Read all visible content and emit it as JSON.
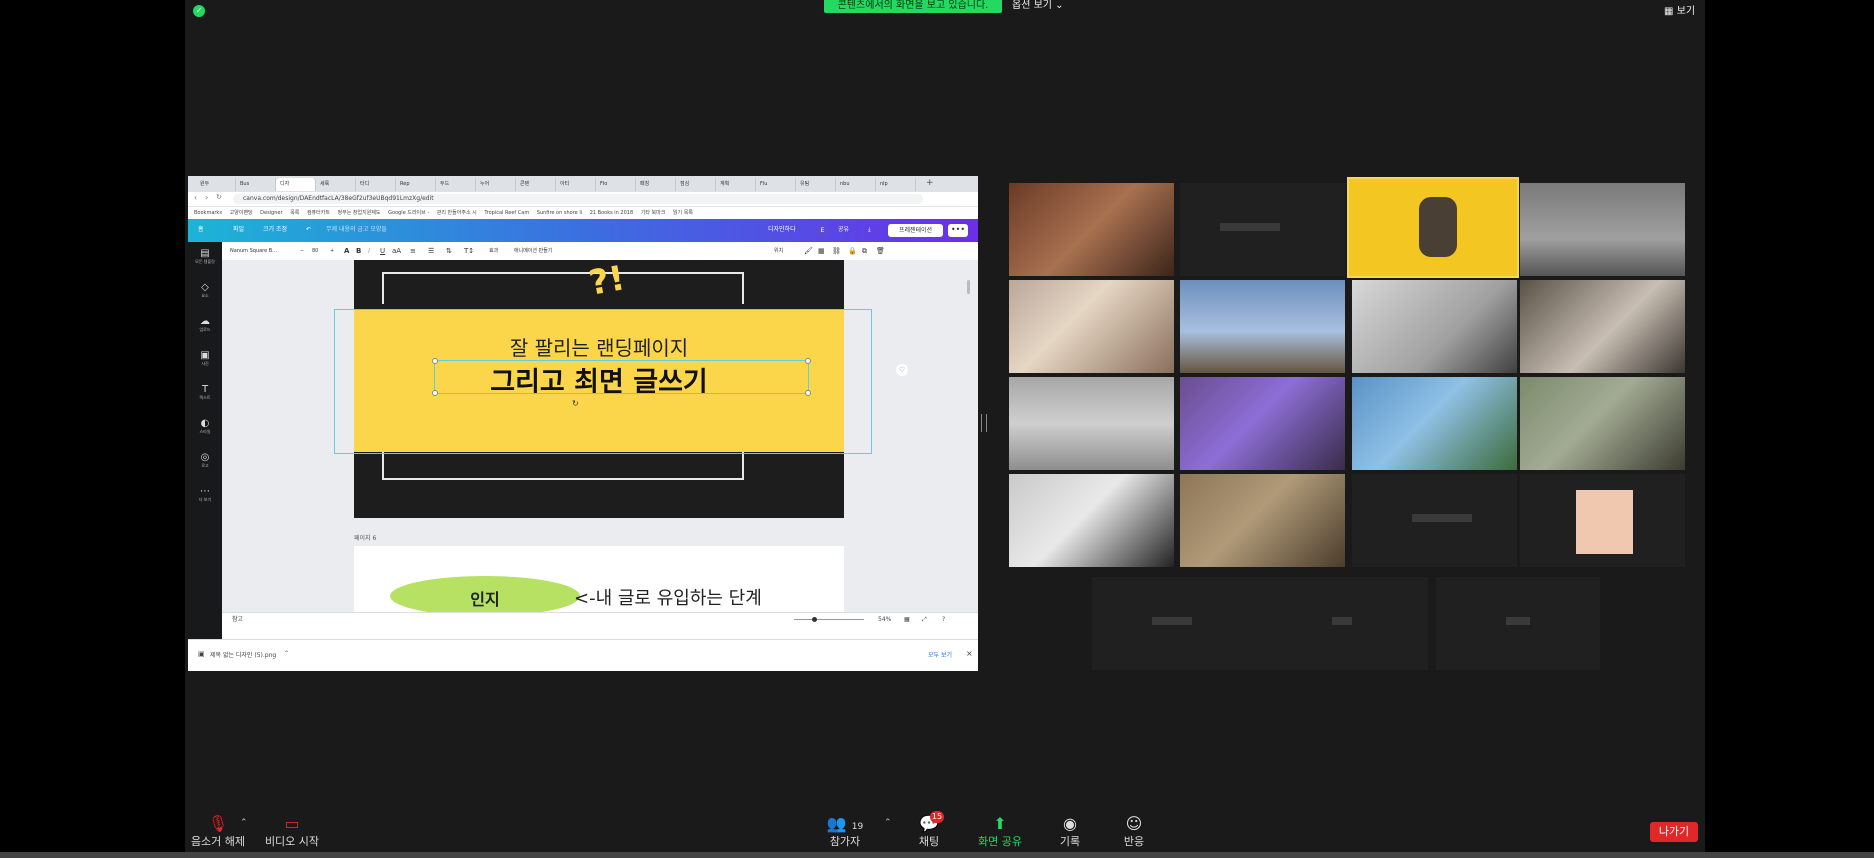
{
  "zoom": {
    "share_banner": "콘텐츠에서의 화면을 보고 있습니다.",
    "view_options": "옵션 보기 ⌄",
    "view_button": "보기",
    "controls": {
      "mute": "음소거 해제",
      "video": "비디오 시작",
      "participants": "참가자",
      "participants_count": "19",
      "chat": "채팅",
      "chat_badge": "15",
      "share": "화면 공유",
      "record": "기록",
      "reactions": "반응",
      "leave": "나가기"
    }
  },
  "browser": {
    "url": "canva.com/design/DAEndtfacLA/38eGf2uf3eUBqd91LmzXg/edit",
    "bookmarks": [
      "Bookmarks",
      "고양이펜딩",
      "Designer",
      "목록",
      "컴퓨터카트",
      "정부는 창업지원제도",
      "Google 드라이브 -",
      "관리 만들어주소 시",
      "Tropical Reef Cam",
      "Sunfire on shore li",
      "21 Books in 2018",
      "기타 북마크",
      "읽기 목록"
    ],
    "tabs": [
      "원두",
      "Bus",
      "디자",
      "세륙",
      "타디",
      "Rep",
      "두드",
      "누어",
      "콘텐",
      "아티",
      "Flo",
      "패칭",
      "점심",
      "계획",
      "Flu",
      "유팀",
      "nbu",
      "nlp"
    ]
  },
  "canva": {
    "top": {
      "home": "홈",
      "file": "파일",
      "resize": "크기 조정",
      "title_placeholder": "무제 내용의 금고 모양들",
      "designer": "디자인하다",
      "share": "공유",
      "present": "프레젠테이션"
    },
    "toolbar": {
      "font": "Nanum Square B...",
      "size": "80",
      "effects": "효과",
      "animate": "애니메이션 만들기",
      "position": "위치"
    },
    "sidebar": [
      "모든 템플릿",
      "요소",
      "업로드",
      "사진",
      "텍스트",
      "스타일",
      "로고",
      "더 보기"
    ],
    "slide": {
      "sticker": "?!",
      "subtitle": "잘 팔리는 랜딩페이지",
      "title": "그리고 최면 글쓰기"
    },
    "page_label": "페이지 6",
    "next_slide": {
      "label": "인지",
      "desc": "<-내 글로 유입하는 단계"
    },
    "bottom": {
      "notes": "참고",
      "zoom": "54%"
    },
    "download": {
      "file": "제목 없는 디자인 (5).png",
      "show_all": "모두 보기"
    }
  }
}
